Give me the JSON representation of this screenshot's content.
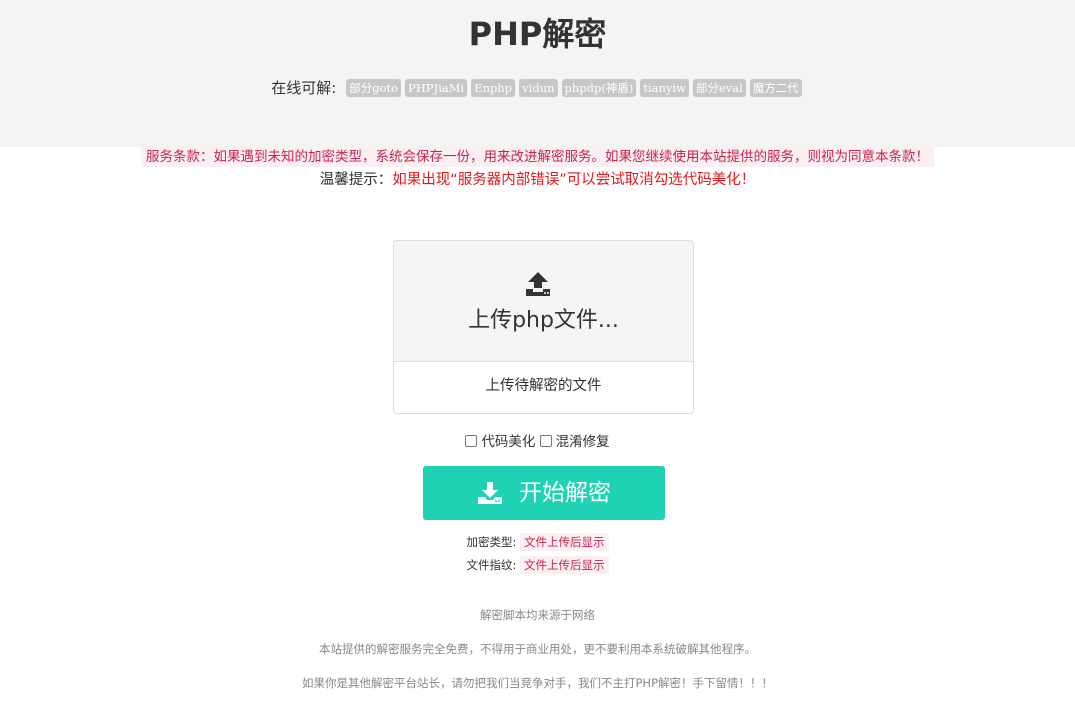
{
  "header": {
    "title": "PHP解密",
    "formats_label": "在线可解:",
    "formats": [
      "部分goto",
      "PHPJiaMi",
      "Enphp",
      "vidun",
      "phpdp(神盾)",
      "tianyiw",
      "部分eval",
      "魔方二代"
    ]
  },
  "notices": {
    "terms": "服务条款：如果遇到未知的加密类型，系统会保存一份，用来改进解密服务。如果您继续使用本站提供的服务，则视为同意本条款！",
    "tip_label": "温馨提示：",
    "tip_text": "如果出现“服务器内部错误”可以尝试取消勾选代码美化！"
  },
  "upload": {
    "icon": "upload-icon",
    "title": "上传php文件...",
    "hint": "上传待解密的文件"
  },
  "options": {
    "beautify": {
      "label": "代码美化",
      "checked": false
    },
    "obfuscation_fix": {
      "label": "混淆修复",
      "checked": false
    }
  },
  "start_button": {
    "icon": "download-icon",
    "label": "开始解密",
    "color": "#1ed2b3"
  },
  "info": {
    "encryption_type_label": "加密类型:",
    "encryption_type_value": "文件上传后显示",
    "fingerprint_label": "文件指纹:",
    "fingerprint_value": "文件上传后显示"
  },
  "footer": {
    "line1": "解密脚本均来源于网络",
    "line2": "本站提供的解密服务完全免费，不得用于商业用处，更不要利用本系统破解其他程序。",
    "line3": "如果你是其他解密平台站长，请勿把我们当竞争对手，我们不主打PHP解密！手下留情！！！"
  },
  "colors": {
    "header_bg": "#f4f4f4",
    "tag_bg": "#c7c7c7",
    "terms_text": "#c7254e",
    "terms_bg": "#fbeff2",
    "tip_text": "#e61717",
    "footer_text": "#888888"
  }
}
